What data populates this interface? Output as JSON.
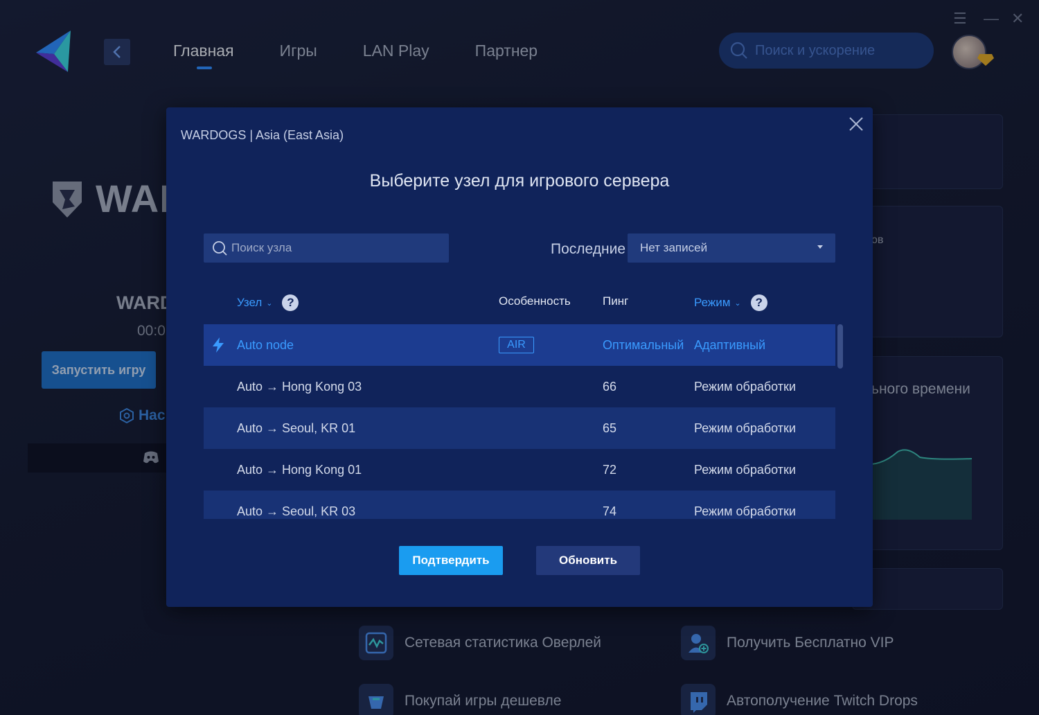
{
  "nav": {
    "items": [
      "Главная",
      "Игры",
      "LAN Play",
      "Партнер"
    ],
    "active_index": 0
  },
  "top_search": {
    "placeholder": "Поиск и ускорение"
  },
  "game_panel": {
    "logo_text": "WAR",
    "game_name": "WARD",
    "timer": "00:0",
    "launch_label": "Запустить игру",
    "settings_label": "Нас"
  },
  "right_panel": {
    "partial_text_1": "ов",
    "partial_text_2": "ьного времени"
  },
  "features": [
    {
      "icon": "network-stats-icon",
      "label": "Сетевая статистика Оверлей"
    },
    {
      "icon": "user-vip-icon",
      "label": "Получить Бесплатно VIP"
    },
    {
      "icon": "cart-icon",
      "label": "Покупай игры дешевле"
    },
    {
      "icon": "twitch-icon",
      "label": "Автополучение Twitch Drops"
    }
  ],
  "modal": {
    "subtitle": "WARDOGS | Asia (East Asia)",
    "title": "Выберите узел для игрового сервера",
    "search_placeholder": "Поиск узла",
    "recent_label": "Последние",
    "recent_value": "Нет записей",
    "columns": {
      "node": "Узел",
      "feature": "Особенность",
      "ping": "Пинг",
      "mode": "Режим"
    },
    "rows": [
      {
        "node": "Auto node",
        "feature": "AIR",
        "ping": "Оптимальный",
        "mode": "Адаптивный",
        "selected": true
      },
      {
        "node": "Auto → Hong Kong 03",
        "feature": "",
        "ping": "66",
        "mode": "Режим обработки"
      },
      {
        "node": "Auto → Seoul, KR 01",
        "feature": "",
        "ping": "65",
        "mode": "Режим обработки"
      },
      {
        "node": "Auto → Hong Kong 01",
        "feature": "",
        "ping": "72",
        "mode": "Режим обработки"
      },
      {
        "node": "Auto → Seoul, KR 03",
        "feature": "",
        "ping": "74",
        "mode": "Режим обработки"
      }
    ],
    "confirm_label": "Подтвердить",
    "refresh_label": "Обновить",
    "help_glyph": "?"
  },
  "colors": {
    "accent": "#1a9cf0",
    "link_blue": "#3a9bff",
    "modal_bg": "#10235a",
    "row_alt": "#183275",
    "row_selected": "#1c3c90"
  }
}
